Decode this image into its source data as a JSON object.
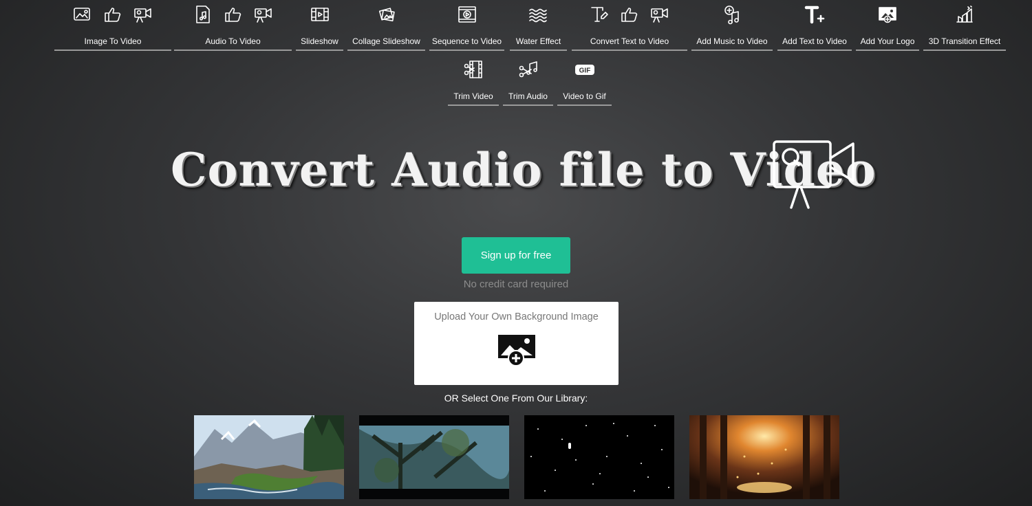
{
  "nav": {
    "row1": [
      {
        "label": "Image To Video",
        "icons": [
          "image-icon",
          "thumbs-up-icon",
          "video-camera-icon"
        ]
      },
      {
        "label": "Audio To Video",
        "icons": [
          "music-file-icon",
          "thumbs-up-icon",
          "video-camera-icon"
        ]
      },
      {
        "label": "Slideshow",
        "icons": [
          "film-icon"
        ]
      },
      {
        "label": "Collage Slideshow",
        "icons": [
          "collage-icon"
        ]
      },
      {
        "label": "Sequence to Video",
        "icons": [
          "sequence-icon"
        ]
      },
      {
        "label": "Water Effect",
        "icons": [
          "water-waves-icon"
        ]
      },
      {
        "label": "Convert Text to Video",
        "icons": [
          "text-icon",
          "thumbs-up-icon",
          "video-camera-icon"
        ]
      },
      {
        "label": "Add Music to Video",
        "icons": [
          "music-add-icon"
        ]
      },
      {
        "label": "Add Text to Video",
        "icons": [
          "text-plus-icon"
        ]
      },
      {
        "label": "Add Your Logo",
        "icons": [
          "logo-add-icon"
        ]
      },
      {
        "label": "3D Transition Effect",
        "icons": [
          "transition-icon"
        ]
      }
    ],
    "row2": [
      {
        "label": "Trim Video",
        "icons": [
          "trim-video-icon"
        ]
      },
      {
        "label": "Trim Audio",
        "icons": [
          "trim-audio-icon"
        ]
      },
      {
        "label": "Video to Gif",
        "icons": [
          "gif-icon"
        ]
      }
    ]
  },
  "hero": {
    "title": "Convert Audio file to Video",
    "icon": "video-camera-icon"
  },
  "signup": {
    "button_label": "Sign up for free",
    "note": "No credit card required"
  },
  "upload": {
    "label": "Upload Your Own Background Image",
    "icon": "image-add-icon"
  },
  "library": {
    "heading": "OR Select One From Our Library:",
    "thumbnails": [
      "mountain-stream-thumbnail",
      "tree-branches-thumbnail",
      "falling-snow-thumbnail",
      "glowing-forest-thumbnail"
    ]
  },
  "colors": {
    "accent": "#1fbf95",
    "background": "#343537",
    "text": "#ffffff",
    "muted": "#8c8c8c"
  }
}
